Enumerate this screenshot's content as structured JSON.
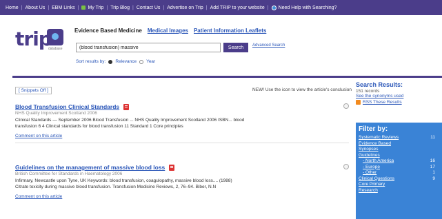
{
  "topnav": {
    "items": [
      "Home",
      "About Us",
      "EBM Links",
      "My Trip",
      "Trip Blog",
      "Contact Us",
      "Advertise on Trip",
      "Add TRIP to your website",
      "Need Help with Searching?"
    ]
  },
  "logo": {
    "word": "trip",
    "sub": "database"
  },
  "tabs": {
    "active": "Evidence Based Medicine",
    "images": "Medical Images",
    "leaflets": "Patient Information Leaflets"
  },
  "search": {
    "value": "(blood transfusion) massive",
    "button": "Search",
    "advanced": "Advanced Search"
  },
  "sort": {
    "label": "Sort results by:",
    "opt1": "Relevance",
    "opt2": "Year"
  },
  "main": {
    "snippets_button": "[ Snippets Off ]",
    "tip": "NEW! Use the   icon to view the article's conclusion"
  },
  "results": [
    {
      "title": "Blood Transfusion Clinical Standards",
      "source": "NHS Quality Improvement Scotland 2006",
      "snippet_lines": [
        "Clinical Standards — September 2006 Blood Transfusion ... NHS Quality Improvement Scotland 2006 ISBN... blood",
        "transfusion 6 4 Clinical standards for blood transfusion 11 Standard 1 Core principles"
      ],
      "comment": "Comment on this article"
    },
    {
      "title": "Guidelines on the management of massive blood loss",
      "source": "British Committee for Standards in Haematology 2006",
      "snippet_lines": [
        "Infirmary, Newcastle upon Tyne, UK Keywords: blood transfusion, coagulopathy, massive blood loss.... (1988)",
        "Citrate toxicity during massive blood transfusion. Transfusion Medicine Reviews, 2, 76–94. Biber, N.N"
      ],
      "comment": "Comment on this article"
    }
  ],
  "sidebar": {
    "title": "Search Results:",
    "count": "151 records",
    "synonyms": "See the synonyms used",
    "rss": "RSS These Results"
  },
  "filter": {
    "title": "Filter by:",
    "rows": [
      {
        "label": "Systematic Reviews",
        "count": "11",
        "sub": false
      },
      {
        "label": "Evidence Based",
        "count": "",
        "sub": false
      },
      {
        "label": "Synopses",
        "count": "",
        "sub": false
      },
      {
        "label": "Guidelines",
        "count": "",
        "sub": false
      },
      {
        "label": "- North America",
        "count": "16",
        "sub": true
      },
      {
        "label": "- Europe",
        "count": "17",
        "sub": true
      },
      {
        "label": "- Other",
        "count": "1",
        "sub": true
      },
      {
        "label": "Clinical Questions",
        "count": "9",
        "sub": false
      },
      {
        "label": "Core Primary",
        "count": "",
        "sub": false
      },
      {
        "label": "Research",
        "count": "",
        "sub": false
      }
    ]
  },
  "colors": {
    "brand": "#4b3d8a",
    "link": "#2a56b8",
    "filter_bg": "#3a83d6"
  }
}
